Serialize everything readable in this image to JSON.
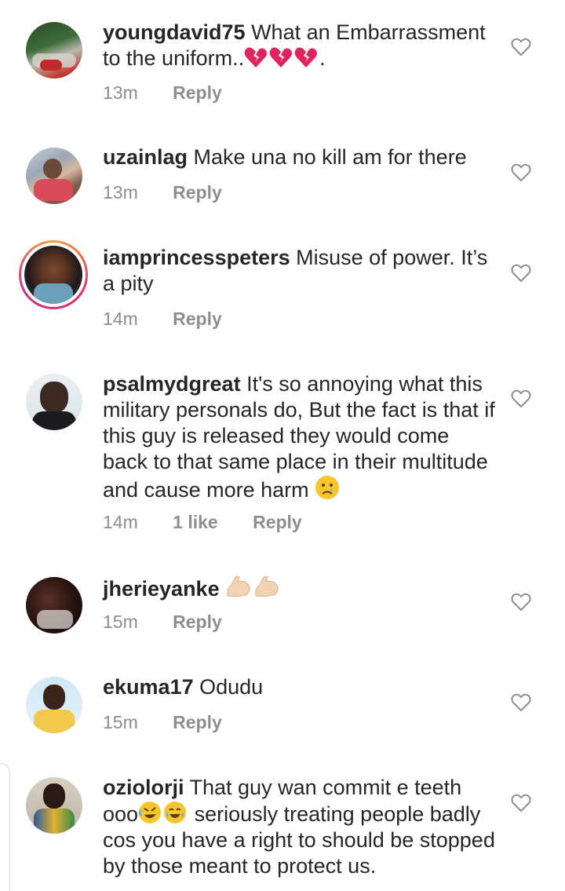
{
  "comments": [
    {
      "username": "youngdavid75",
      "text": "What an Embarrassment to the uniform..",
      "suffix": ".",
      "time": "13m",
      "likes": "",
      "reply": "Reply",
      "emojis": [
        "broken-heart",
        "broken-heart",
        "broken-heart"
      ]
    },
    {
      "username": "uzainlag",
      "text": "Make una no kill am for there",
      "time": "13m",
      "likes": "",
      "reply": "Reply"
    },
    {
      "username": "iamprincesspeters",
      "text": "Misuse of power. It’s a pity",
      "time": "14m",
      "likes": "",
      "reply": "Reply"
    },
    {
      "username": "psalmydgreat",
      "text": "It's so annoying what this military personals do, But the fact is that if this guy is released they would come back to that same place in their multitude and cause more harm",
      "time": "14m",
      "likes": "1 like",
      "reply": "Reply",
      "emojis": [
        "crying-face"
      ]
    },
    {
      "username": "jherieyanke",
      "text": "",
      "time": "15m",
      "likes": "",
      "reply": "Reply",
      "emojis": [
        "flexed-biceps",
        "flexed-biceps"
      ]
    },
    {
      "username": "ekuma17",
      "text": "Odudu",
      "time": "15m",
      "likes": "",
      "reply": "Reply"
    },
    {
      "username": "oziolorji",
      "text_a": "That guy wan commit e teeth ooo",
      "text_b": "seriously treating people badly cos you have a right to should be stopped by those meant to protect us.",
      "time": "",
      "likes": "",
      "reply": "",
      "emojis": [
        "rolling-laughing",
        "tears-of-joy"
      ]
    }
  ],
  "colors": {
    "text": "#262626",
    "meta": "#8e8e8e",
    "broken_heart": "#e0245e",
    "emoji_yellow": "#f8c52b"
  },
  "icons": {
    "like": "heart-outline-icon"
  }
}
